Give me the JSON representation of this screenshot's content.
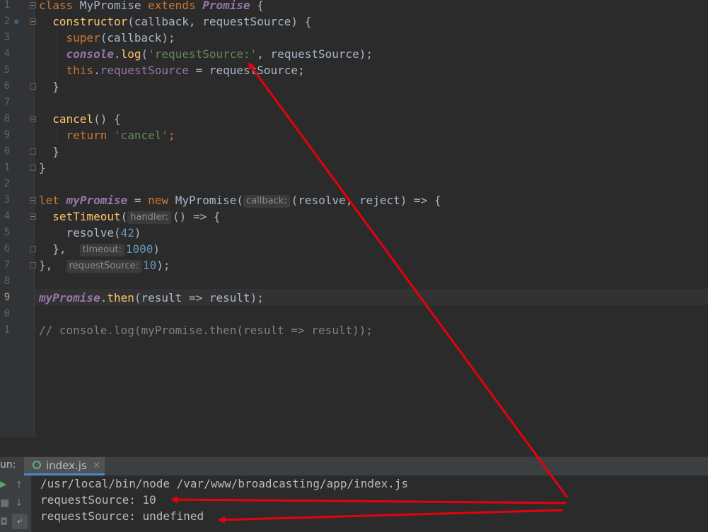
{
  "gutter": {
    "line_numbers": [
      "1",
      "2",
      "3",
      "4",
      "5",
      "6",
      "7",
      "8",
      "9",
      "0",
      "1",
      "2",
      "3",
      "4",
      "5",
      "6",
      "7",
      "8",
      "9",
      "0",
      "1"
    ],
    "active_line_index": 18
  },
  "code": {
    "l1": {
      "kw": "class",
      "name": " MyPromise ",
      "kw2": "extends",
      "sp": " ",
      "cls": "Promise",
      "brace": " {"
    },
    "l2": {
      "fn": "constructor",
      "params": "(callback, requestSource) {"
    },
    "l3": {
      "fn": "super",
      "rest": "(callback);"
    },
    "l4": {
      "obj": "console",
      "dot": ".",
      "fn": "log",
      "open": "(",
      "str": "'requestSource:'",
      "rest": ", requestSource);"
    },
    "l5": {
      "kw": "this",
      "dot": ".",
      "prop": "requestSource",
      "rest": " = requestSource;"
    },
    "l6": {
      "text": "}"
    },
    "l8": {
      "fn": "cancel",
      "rest": "() {"
    },
    "l9": {
      "kw": "return",
      "sp": " ",
      "str": "'cancel'",
      "semi": ";"
    },
    "l10": {
      "text": "}"
    },
    "l11": {
      "text": "}"
    },
    "l13": {
      "kw": "let",
      "sp": " ",
      "var": "myPromise",
      "eq": " = ",
      "kw2": "new",
      "cls": " MyPromise(",
      "hint": "callback:",
      "args": "(resolve, reject) => {"
    },
    "l14": {
      "fn": "setTimeout",
      "open": "(",
      "hint": "handler:",
      "rest": "() => {"
    },
    "l15": {
      "fn": "resolve",
      "open": "(",
      "num": "42",
      "close": ")"
    },
    "l16": {
      "pre": "},",
      "hint": "timeout:",
      "num": "1000",
      "close": ")"
    },
    "l17": {
      "pre": "},",
      "hint": "requestSource:",
      "num": "10",
      "close": ");"
    },
    "l19": {
      "var": "myPromise",
      "dot": ".",
      "fn": "then",
      "rest": "(result => result);"
    },
    "l21": {
      "comment": "// console.log(myPromise.then(result => result));"
    }
  },
  "run_panel": {
    "label": "un:",
    "tab_label": "index.js",
    "tab_close": "×",
    "console_lines": [
      "/usr/local/bin/node /var/www/broadcasting/app/index.js",
      "requestSource: 10",
      "requestSource: undefined"
    ]
  },
  "icons": {
    "tab_icon": "nodejs-icon",
    "toolbar": [
      "run-icon",
      "up-arrow-icon",
      "stop-icon",
      "down-arrow-icon",
      "soft-wrap-icon",
      "camera-icon"
    ]
  },
  "colors": {
    "background": "#2b2b2b",
    "keyword": "#cc7832",
    "function": "#ffc66d",
    "string": "#6a8759",
    "number": "#6897bb",
    "annotation_arrow": "#e8000b"
  }
}
